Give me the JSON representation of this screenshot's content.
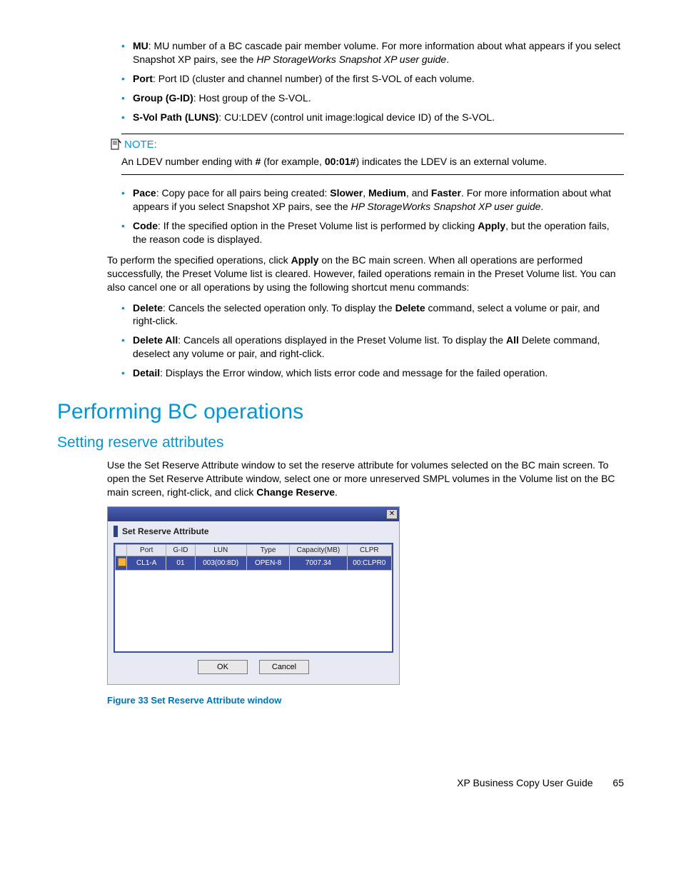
{
  "top_bullets": [
    {
      "term": "MU",
      "text_before": ": MU number of a BC cascade pair member volume. For more information about what appears if you select Snapshot XP pairs, see the ",
      "italic": "HP StorageWorks Snapshot XP user guide",
      "text_after": "."
    },
    {
      "term": "Port",
      "text_before": ": Port ID (cluster and channel number) of the first S-VOL of each volume.",
      "italic": "",
      "text_after": ""
    },
    {
      "term": "Group (G-ID)",
      "text_before": ": Host group of the S-VOL.",
      "italic": "",
      "text_after": ""
    },
    {
      "term": "S-Vol Path (LUNS)",
      "text_before": ": CU:LDEV (control unit image:logical device ID) of the S-VOL.",
      "italic": "",
      "text_after": ""
    }
  ],
  "note": {
    "label": "NOTE:",
    "text_pre": "An LDEV number ending with ",
    "hash": "#",
    "text_mid": " (for example, ",
    "example": "00:01#",
    "text_post": ") indicates the LDEV is an external volume."
  },
  "mid_bullets": {
    "pace": {
      "term": "Pace",
      "t1": ": Copy pace for all pairs being created: ",
      "b1": "Slower",
      "c1": ", ",
      "b2": "Medium",
      "c2": ", and ",
      "b3": "Faster",
      "t2": ". For more information about what appears if you select Snapshot XP pairs, see the ",
      "italic": "HP StorageWorks Snapshot XP user guide",
      "t3": "."
    },
    "code": {
      "term": "Code",
      "t1": ": If the specified option in the Preset Volume list is performed by clicking ",
      "b1": "Apply",
      "t2": ", but the operation fails, the reason code is displayed."
    }
  },
  "para": {
    "t1": "To perform the specified operations, click ",
    "b1": "Apply",
    "t2": " on the BC main screen. When all operations are performed successfully, the Preset Volume list is cleared. However, failed operations remain in the Preset Volume list. You can also cancel one or all operations by using the following shortcut menu commands:"
  },
  "cmd_bullets": {
    "del": {
      "term": "Delete",
      "t1": ": Cancels the selected operation only. To display the ",
      "b1": "Delete",
      "t2": " command, select a volume or pair, and right-click."
    },
    "delall": {
      "term": "Delete All",
      "t1": ": Cancels all operations displayed in the Preset Volume list. To display the ",
      "b1": "All",
      "t2": " Delete command, deselect any volume or pair, and right-click."
    },
    "detail": {
      "term": "Detail",
      "t1": ": Displays the Error window, which lists error code and message for the failed operation."
    }
  },
  "h1": "Performing BC operations",
  "h2": "Setting reserve attributes",
  "para2": {
    "t1": "Use the Set Reserve Attribute window to set the reserve attribute for volumes selected on the BC main screen. To open the Set Reserve Attribute window, select one or more unreserved SMPL volumes in the Volume list on the BC main screen, right-click, and click ",
    "b1": "Change Reserve",
    "t2": "."
  },
  "window": {
    "subtitle": "Set Reserve Attribute",
    "columns": [
      "Port",
      "G-ID",
      "LUN",
      "Type",
      "Capacity(MB)",
      "CLPR"
    ],
    "row": {
      "port": "CL1-A",
      "gid": "01",
      "lun": "003(00:8D)",
      "type": "OPEN-8",
      "cap": "7007.34",
      "clpr": "00:CLPR0"
    },
    "ok": "OK",
    "cancel": "Cancel"
  },
  "figure_caption": "Figure 33 Set Reserve Attribute window",
  "footer": {
    "title": "XP Business Copy User Guide",
    "page": "65"
  }
}
